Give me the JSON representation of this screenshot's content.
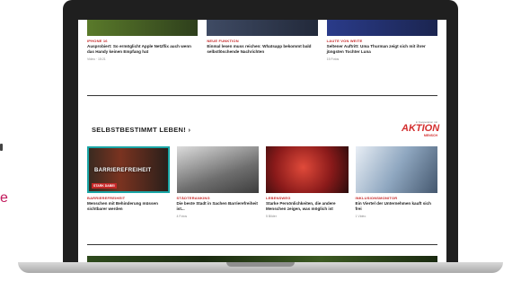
{
  "edge": {
    "letter": "e"
  },
  "top_articles": [
    {
      "category": "IPHONE 16",
      "title": "Ausprobiert: So ermöglicht Apple Netzflix auch wenn das Handy keinen Empfang hat",
      "meta": "Video · 15:21"
    },
    {
      "category": "NEUE FUNKTION",
      "title": "Einmal lesen muss reichen: Whatsapp bekommt bald selbstlöschende Nachrichten",
      "meta": ""
    },
    {
      "category": "LAUTE VON WEITE",
      "title": "Seltener Auftritt: Uma Thurman zeigt sich mit ihrer jüngsten Tochter Luna",
      "meta": "15 Fotos"
    }
  ],
  "section": {
    "title": "SELBSTBESTIMMT LEBEN!",
    "partner_small": "in Kooperation mit",
    "partner_logo": "AKTION",
    "partner_sub": "MENSCH"
  },
  "mid_articles": [
    {
      "category": "BARRIEREFREIHEIT",
      "title": "Menschen mit Behinderung müssen sichtbarer werden",
      "meta": "",
      "overlay": "BARRIEREFREIHEIT",
      "overlay_tag": "STARK DABEI"
    },
    {
      "category": "STÄDTERANKING",
      "title": "Die beste Stadt in Sachen Barrierefreiheit ist...",
      "meta": "4 Fotos"
    },
    {
      "category": "LEBENSWEG",
      "title": "Starke Persönlichkeiten, die andere Menschen zeigen, was möglich ist",
      "meta": "5 Bilder"
    },
    {
      "category": "INKLUSIONSMONITOR",
      "title": "Ein Viertel der Unternehmen kauft sich frei",
      "meta": "1 Video"
    }
  ]
}
